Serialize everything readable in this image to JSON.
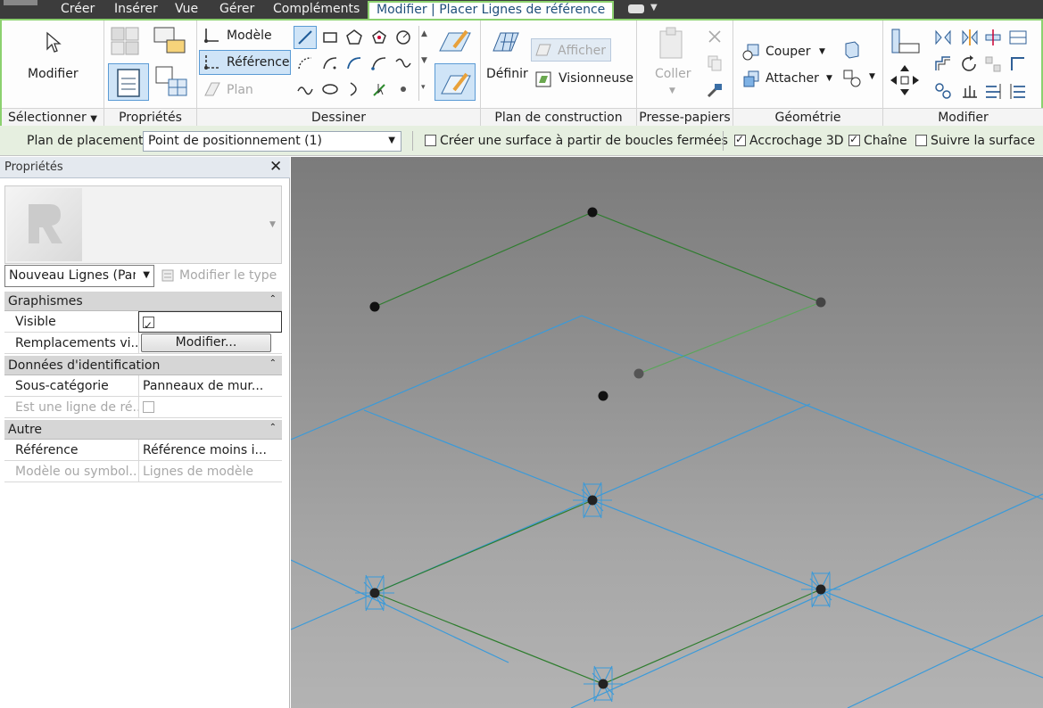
{
  "menubar": {
    "tabs": [
      "Créer",
      "Insérer",
      "Vue",
      "Gérer",
      "Compléments"
    ],
    "active_tab": "Modifier | Placer Lignes de référence"
  },
  "ribbon": {
    "select": {
      "modify_label": "Modifier",
      "title": "Sélectionner"
    },
    "properties": {
      "title": "Propriétés"
    },
    "draw": {
      "modele_label": "Modèle",
      "reference_label": "Référence",
      "plan_label": "Plan",
      "title": "Dessiner"
    },
    "workplane": {
      "define_label": "Définir",
      "show_label": "Afficher",
      "viewer_label": "Visionneuse",
      "title": "Plan de construction"
    },
    "clipboard": {
      "paste_label": "Coller",
      "title": "Presse-papiers"
    },
    "geometry": {
      "cut_label": "Couper",
      "join_label": "Attacher",
      "title": "Géométrie"
    },
    "modify": {
      "title": "Modifier"
    }
  },
  "options": {
    "placement_label": "Plan de placement:",
    "placement_value": "Point de positionnement (1)",
    "create_surface_label": "Créer une surface à partir de boucles fermées",
    "snap3d_label": "Accrochage 3D",
    "chain_label": "Chaîne",
    "follow_surface_label": "Suivre la surface"
  },
  "properties": {
    "title": "Propriétés",
    "type_value": "Nouveau Lignes (Pan",
    "edit_type_label": "Modifier le type",
    "groups": {
      "graphics": "Graphismes",
      "identity": "Données d'identification",
      "other": "Autre"
    },
    "rows": {
      "visible": "Visible",
      "overrides": "Remplacements vi...",
      "overrides_button": "Modifier...",
      "subcategory": "Sous-catégorie",
      "subcategory_value": "Panneaux de mur...",
      "is_ref_line": "Est une ligne de ré...",
      "reference": "Référence",
      "reference_value": "Référence moins i...",
      "model_symbolic": "Modèle ou symbol...",
      "model_symbolic_value": "Lignes de modèle"
    }
  },
  "colors": {
    "accent_green": "#8cd16f",
    "grid_blue": "#3a9ad9",
    "line_green": "#2e7d2e"
  }
}
